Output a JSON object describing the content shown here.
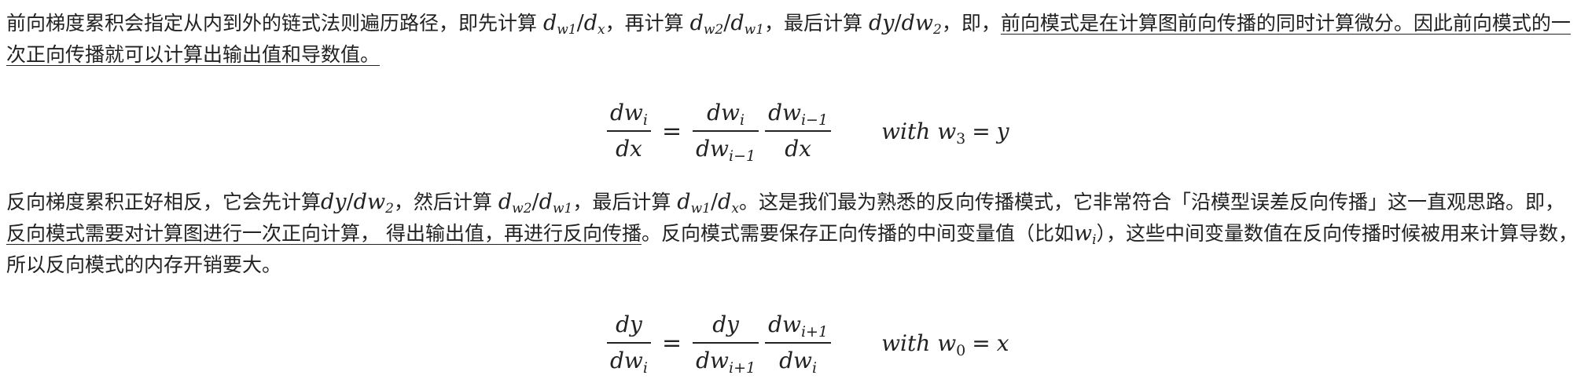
{
  "paragraph1": {
    "text_a": "前向梯度累积会指定从内到外的链式法则遍历路径，即先计算 ",
    "text_b": "，再计算 ",
    "text_c": "，最后计算 ",
    "text_d": "，即，",
    "underline_1": "前向模式是在计算图前向传播的同时计算微分。",
    "underline_2": "因此前向模式的一次正向传播就可以计算出输出值和导数值。"
  },
  "equation1": {
    "lhs_num": "dw",
    "lhs_num_sub": "i",
    "lhs_den": "dx",
    "r1_num": "dw",
    "r1_num_sub": "i",
    "r1_den": "dw",
    "r1_den_sub": "i−1",
    "r2_num": "dw",
    "r2_num_sub": "i−1",
    "r2_den": "dx",
    "with_word": "with",
    "with_var": "w",
    "with_var_sub": "3",
    "with_rhs": "y"
  },
  "paragraph2": {
    "text_a": "反向梯度累积正好相反，它会先计算",
    "text_b": "，然后计算 ",
    "text_c": "，最后计算 ",
    "text_d": "。这是我们最为熟悉的反向传播模式，它非常符合「沿模型误差反向传播」这一直观思路。即，",
    "underline_1": "反向模式需要对计算图进行一次正向计算， 得出输出值，再进行反向传播",
    "text_e": "。反向模式需要保存正向传播的中间变量值（比如",
    "text_f": "），这些中间变量数值在反向传播时候被用来计算导数，所以反向模式的内存开销要大。"
  },
  "equation2": {
    "lhs_num": "dy",
    "lhs_den": "dw",
    "lhs_den_sub": "i",
    "r1_num": "dy",
    "r1_den": "dw",
    "r1_den_sub": "i+1",
    "r2_num": "dw",
    "r2_num_sub": "i+1",
    "r2_den": "dw",
    "r2_den_sub": "i",
    "with_word": "with",
    "with_var": "w",
    "with_var_sub": "0",
    "with_rhs": "x"
  },
  "inline_math": {
    "dw1_dx": {
      "a": "d",
      "a_sub": "w1",
      "sep": "/",
      "b": "d",
      "b_sub": "x"
    },
    "dw2_dw1": {
      "a": "d",
      "a_sub": "w2",
      "sep": "/",
      "b": "d",
      "b_sub": "w1"
    },
    "dy_dw2": {
      "a": "dy",
      "sep": "/",
      "b": "dw",
      "b_sub": "2"
    },
    "wi": {
      "a": "w",
      "a_sub": "i"
    }
  }
}
